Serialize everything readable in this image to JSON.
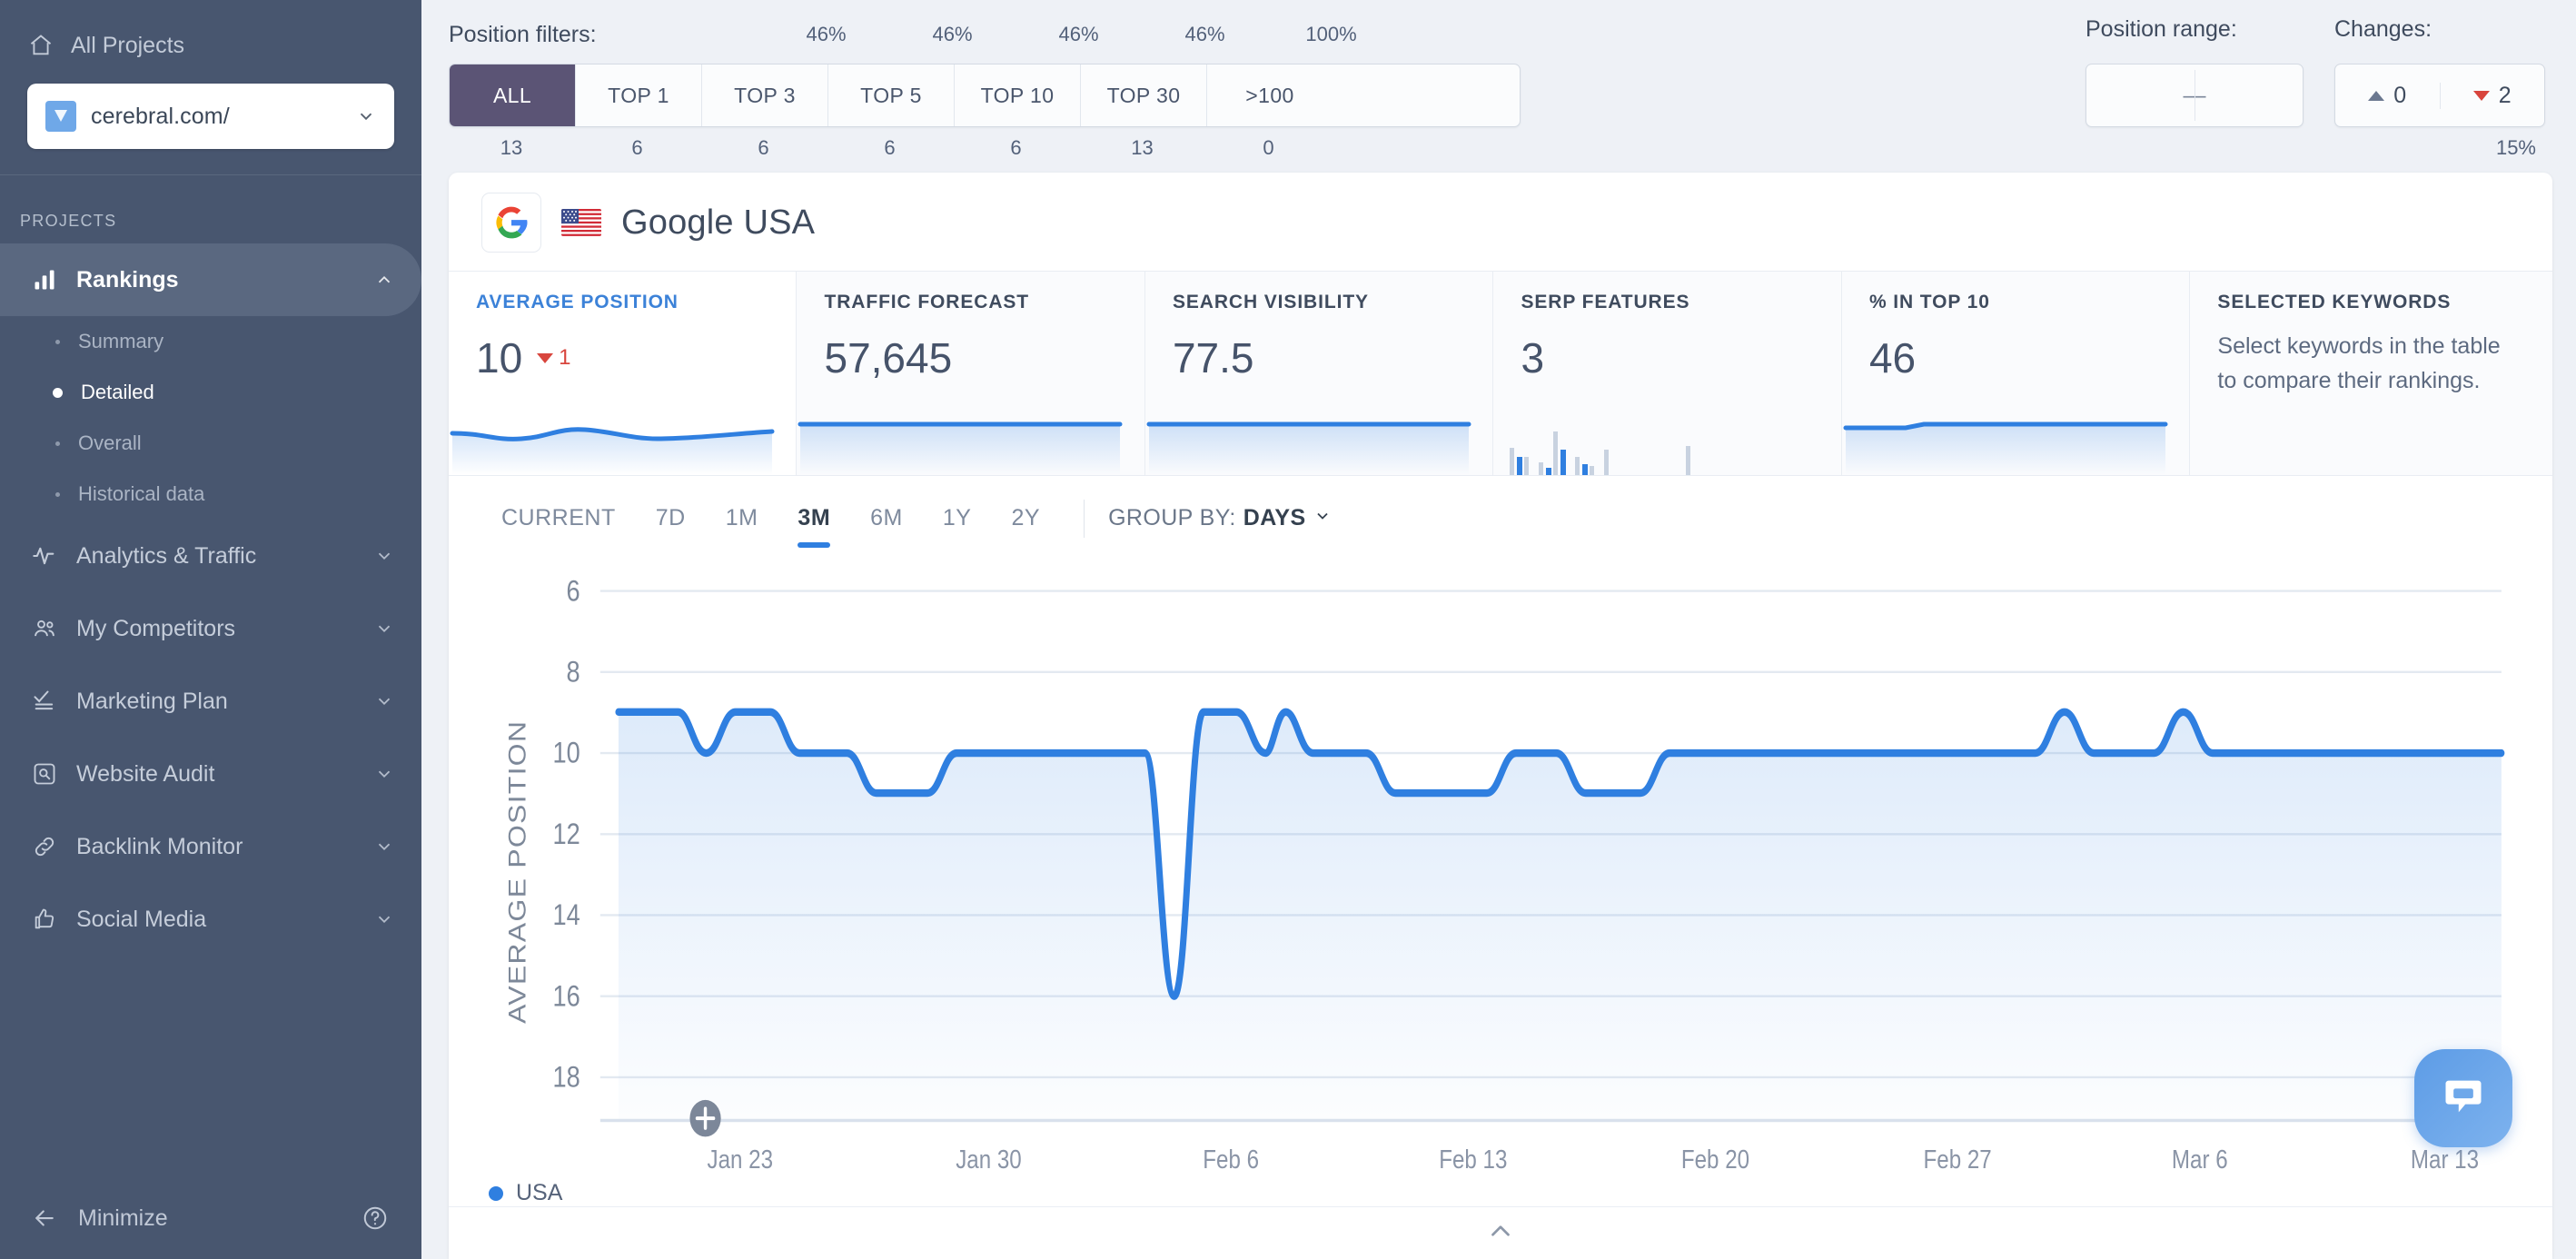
{
  "sidebar": {
    "all_projects": "All Projects",
    "project": "cerebral.com/",
    "section_label": "PROJECTS",
    "nav": [
      {
        "label": "Rankings",
        "icon": "bar-chart-icon",
        "active": true,
        "expanded": true,
        "children": [
          {
            "label": "Summary",
            "active": false
          },
          {
            "label": "Detailed",
            "active": true
          },
          {
            "label": "Overall",
            "active": false
          },
          {
            "label": "Historical data",
            "active": false
          }
        ]
      },
      {
        "label": "Analytics & Traffic",
        "icon": "pulse-icon",
        "active": false,
        "expanded": false
      },
      {
        "label": "My Competitors",
        "icon": "people-icon",
        "active": false,
        "expanded": false
      },
      {
        "label": "Marketing Plan",
        "icon": "checklist-icon",
        "active": false,
        "expanded": false
      },
      {
        "label": "Website Audit",
        "icon": "magnifier-box-icon",
        "active": false,
        "expanded": false
      },
      {
        "label": "Backlink Monitor",
        "icon": "link-icon",
        "active": false,
        "expanded": false
      },
      {
        "label": "Social Media",
        "icon": "thumbs-up-icon",
        "active": false,
        "expanded": false
      }
    ],
    "minimize": "Minimize"
  },
  "filters": {
    "position_filters_label": "Position filters:",
    "segments": [
      {
        "label": "ALL",
        "percent": "",
        "count": "13",
        "active": true
      },
      {
        "label": "TOP 1",
        "percent": "46%",
        "count": "6",
        "active": false
      },
      {
        "label": "TOP 3",
        "percent": "46%",
        "count": "6",
        "active": false
      },
      {
        "label": "TOP 5",
        "percent": "46%",
        "count": "6",
        "active": false
      },
      {
        "label": "TOP 10",
        "percent": "46%",
        "count": "6",
        "active": false
      },
      {
        "label": "TOP 30",
        "percent": "100%",
        "count": "13",
        "active": false
      },
      {
        "label": ">100",
        "percent": "",
        "count": "0",
        "active": false
      }
    ],
    "position_range_label": "Position range:",
    "position_range_value": "—",
    "changes_label": "Changes:",
    "changes_up": "0",
    "changes_down": "2",
    "changes_percent": "15%"
  },
  "engine": {
    "logo": "google-icon",
    "flag": "usa-flag-icon",
    "name": "Google USA"
  },
  "metrics": [
    {
      "label": "AVERAGE POSITION",
      "value": "10",
      "delta": "1",
      "delta_dir": "down",
      "active": true,
      "spark": "line"
    },
    {
      "label": "TRAFFIC FORECAST",
      "value": "57,645",
      "active": false,
      "spark": "line"
    },
    {
      "label": "SEARCH VISIBILITY",
      "value": "77.5",
      "active": false,
      "spark": "line"
    },
    {
      "label": "SERP FEATURES",
      "value": "3",
      "active": false,
      "spark": "bars"
    },
    {
      "label": "% IN TOP 10",
      "value": "46",
      "active": false,
      "spark": "line"
    },
    {
      "label": "SELECTED KEYWORDS",
      "description": "Select keywords in the table to compare their rankings.",
      "active": false,
      "spark": "none"
    }
  ],
  "timebar": {
    "tabs": [
      {
        "label": "CURRENT",
        "active": false
      },
      {
        "label": "7D",
        "active": false
      },
      {
        "label": "1M",
        "active": false
      },
      {
        "label": "3M",
        "active": true
      },
      {
        "label": "6M",
        "active": false
      },
      {
        "label": "1Y",
        "active": false
      },
      {
        "label": "2Y",
        "active": false
      }
    ],
    "group_by_label": "GROUP BY:",
    "group_by_value": "DAYS"
  },
  "legend": [
    {
      "label": "USA",
      "color": "#2f7fe0"
    }
  ],
  "colors": {
    "accent": "#2f7fe0",
    "active_filter": "#5b5475",
    "down": "#d8453d",
    "sidebar": "#48566f"
  },
  "chart_data": {
    "type": "line",
    "title": "",
    "xlabel": "",
    "ylabel": "AVERAGE POSITION",
    "yticks": [
      6,
      8,
      10,
      12,
      14,
      16,
      18
    ],
    "ylim": [
      6,
      18
    ],
    "y_inverted": true,
    "grid": true,
    "legend_position": "bottom-left",
    "xticks": [
      "Jan 23",
      "Jan 30",
      "Feb 6",
      "Feb 13",
      "Feb 20",
      "Feb 27",
      "Mar 6",
      "Mar 13"
    ],
    "series": [
      {
        "name": "USA",
        "color": "#2f7fe0",
        "values": [
          9,
          9,
          9,
          9,
          10,
          9,
          9,
          9,
          9,
          10,
          10,
          10,
          11,
          11,
          11,
          10,
          10,
          10,
          10,
          10,
          10,
          10,
          16,
          9,
          9,
          9,
          10,
          9,
          10,
          9,
          9,
          9,
          9,
          10,
          10,
          11,
          11,
          11,
          10,
          11,
          11,
          10,
          10,
          10,
          10,
          10,
          10,
          10,
          10,
          9,
          10,
          10,
          9,
          10
        ]
      }
    ]
  }
}
